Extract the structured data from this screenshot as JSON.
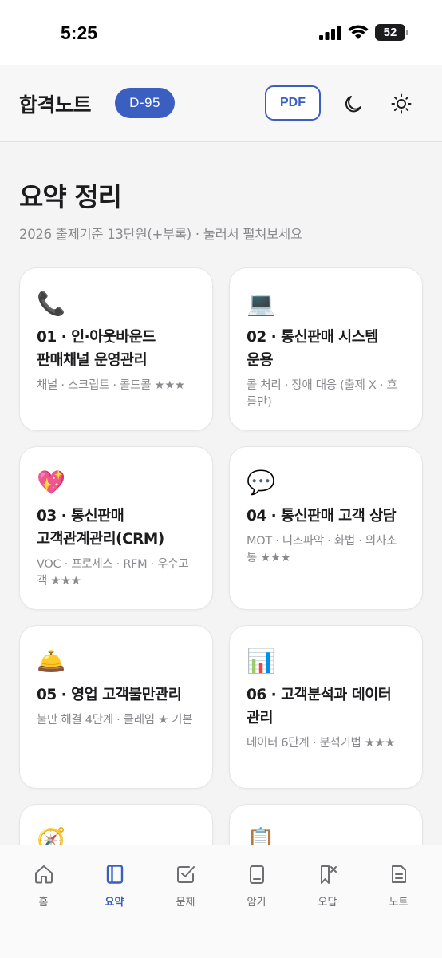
{
  "status_bar": {
    "time": "5:25",
    "battery": "52"
  },
  "header": {
    "title": "합격노트",
    "dday": "D-95",
    "pdf_label": "PDF",
    "icons": [
      "moon-icon",
      "sun-icon"
    ]
  },
  "main": {
    "title": "요약 정리",
    "subtitle": "2026 출제기준 13단원(+부록) · 눌러서 펼쳐보세요",
    "cards": [
      {
        "emoji": "📞",
        "icon": "telephone-icon",
        "title": "01 · 인·아웃바운드 판매채널 운영관리",
        "desc": "채널 · 스크립트 · 콜드콜",
        "stars": "★★★"
      },
      {
        "emoji": "💻",
        "icon": "computer-icon",
        "title": "02 · 통신판매 시스템 운용",
        "desc": "콜 처리 · 장애 대응 (출제 X · 흐름만)",
        "stars": ""
      },
      {
        "emoji": "💖",
        "icon": "sparkling-heart-icon",
        "title": "03 · 통신판매 고객관계관리(CRM)",
        "desc": "VOC · 프로세스 · RFM · 우수고객",
        "stars": "★★★"
      },
      {
        "emoji": "💬",
        "icon": "speech-bubble-icon",
        "title": "04 · 통신판매 고객 상담",
        "desc": "MOT · 니즈파악 · 화법 · 의사소통",
        "stars": "★★★"
      },
      {
        "emoji": "🛎️",
        "icon": "bellhop-bell-icon",
        "title": "05 · 영업 고객불만관리",
        "desc": "불만 해결 4단계 · 클레임 ★ 기본",
        "stars": ""
      },
      {
        "emoji": "📊",
        "icon": "bar-chart-icon",
        "title": "06 · 고객분석과 데이터 관리",
        "desc": "데이터 6단계 · 분석기법",
        "stars": "★★★"
      },
      {
        "emoji": "🧭",
        "icon": "compass-icon",
        "title": "",
        "desc": "",
        "stars": ""
      },
      {
        "emoji": "📋",
        "icon": "clipboard-icon",
        "title": "",
        "desc": "",
        "stars": ""
      }
    ]
  },
  "tab_bar": {
    "tabs": [
      {
        "label": "홈",
        "icon": "home-icon",
        "active": false
      },
      {
        "label": "요약",
        "icon": "book-icon",
        "active": true
      },
      {
        "label": "문제",
        "icon": "checkbox-icon",
        "active": false
      },
      {
        "label": "암기",
        "icon": "flashcard-icon",
        "active": false
      },
      {
        "label": "오답",
        "icon": "bookmark-x-icon",
        "active": false
      },
      {
        "label": "노트",
        "icon": "note-icon",
        "active": false
      }
    ]
  },
  "colors": {
    "accent": "#3b5fc0",
    "muted": "#8a8a8e",
    "background": "#f4f4f4"
  }
}
